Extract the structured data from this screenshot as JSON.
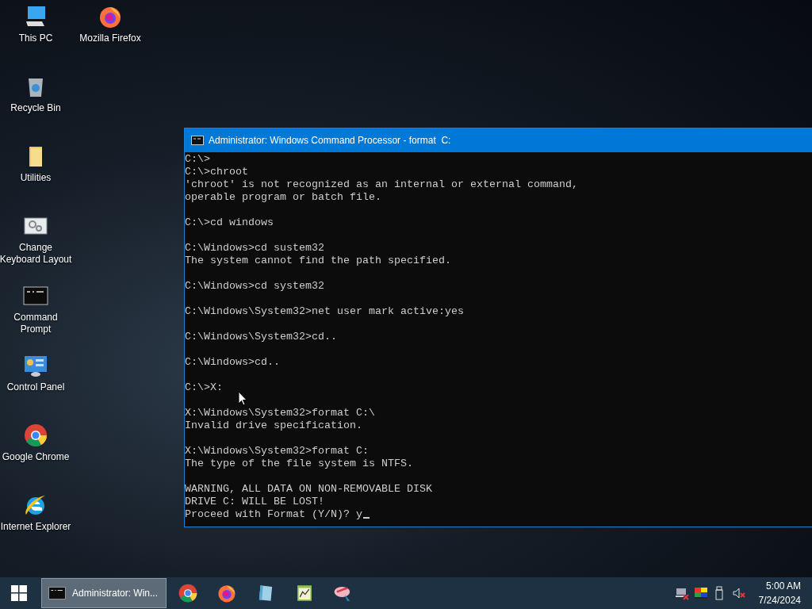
{
  "desktop": {
    "columns": [
      [
        {
          "kind": "pc",
          "label_lines": [
            "This PC"
          ]
        },
        {
          "kind": "recycle",
          "label_lines": [
            "Recycle Bin"
          ]
        },
        {
          "kind": "folder",
          "label_lines": [
            "Utilities"
          ]
        },
        {
          "kind": "keyboard",
          "label_lines": [
            "Change",
            "Keyboard Layout"
          ]
        },
        {
          "kind": "cmd",
          "label_lines": [
            "Command",
            "Prompt"
          ]
        },
        {
          "kind": "control",
          "label_lines": [
            "Control Panel"
          ]
        },
        {
          "kind": "chrome",
          "label_lines": [
            "Google Chrome"
          ]
        },
        {
          "kind": "ie",
          "label_lines": [
            "Internet Explorer"
          ]
        }
      ],
      [
        {
          "kind": "firefox",
          "label_lines": [
            "Mozilla Firefox"
          ]
        }
      ]
    ]
  },
  "window": {
    "title": "Administrator: Windows Command Processor - format  C:",
    "console_blocks": [
      [
        "C:\\>",
        "C:\\>chroot",
        "'chroot' is not recognized as an internal or external command,",
        "operable program or batch file."
      ],
      [
        "C:\\>cd windows"
      ],
      [
        "C:\\Windows>cd sustem32",
        "The system cannot find the path specified."
      ],
      [
        "C:\\Windows>cd system32"
      ],
      [
        "C:\\Windows\\System32>net user mark active:yes"
      ],
      [
        "C:\\Windows\\System32>cd.."
      ],
      [
        "C:\\Windows>cd.."
      ],
      [
        "C:\\>X:"
      ],
      [
        "X:\\Windows\\System32>format C:\\",
        "Invalid drive specification."
      ],
      [
        "X:\\Windows\\System32>format C:",
        "The type of the file system is NTFS."
      ],
      [
        "WARNING, ALL DATA ON NON-REMOVABLE DISK",
        "DRIVE C: WILL BE LOST!",
        "Proceed with Format (Y/N)? y"
      ]
    ]
  },
  "taskbar": {
    "task": {
      "label": "Administrator: Win...",
      "selected": true
    },
    "pinned": [
      {
        "kind": "chrome"
      },
      {
        "kind": "firefox"
      },
      {
        "kind": "notebook"
      },
      {
        "kind": "chart"
      },
      {
        "kind": "paint"
      }
    ],
    "tray": [
      {
        "kind": "network"
      },
      {
        "kind": "color"
      },
      {
        "kind": "usb"
      },
      {
        "kind": "volume"
      }
    ],
    "time": "5:00 AM",
    "date": "7/24/2024"
  }
}
